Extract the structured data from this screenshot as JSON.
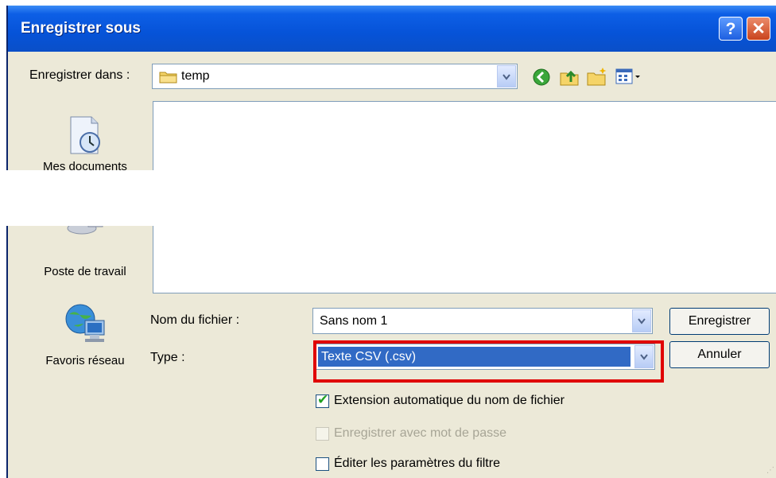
{
  "window": {
    "title": "Enregistrer sous",
    "help_label": "?",
    "close_label": "✕"
  },
  "save_in": {
    "label": "Enregistrer dans :",
    "value": "temp"
  },
  "toolbar": {
    "icons": [
      "back-icon",
      "up-folder-icon",
      "new-folder-icon",
      "view-menu-icon"
    ]
  },
  "places": [
    {
      "label": "Mes documents",
      "icon": "my-documents-icon"
    },
    {
      "label": "Poste de travail",
      "icon": "my-computer-icon"
    },
    {
      "label": "Favoris réseau",
      "icon": "network-places-icon"
    }
  ],
  "filename": {
    "label": "Nom du fichier :",
    "value": "Sans nom 1"
  },
  "filetype": {
    "label": "Type :",
    "value": "Texte CSV (.csv)"
  },
  "buttons": {
    "save": "Enregistrer",
    "cancel": "Annuler"
  },
  "options": [
    {
      "label": "Extension automatique du nom de fichier",
      "checked": true,
      "enabled": true
    },
    {
      "label": "Enregistrer avec mot de passe",
      "checked": false,
      "enabled": false
    },
    {
      "label": "Éditer les paramètres du filtre",
      "checked": false,
      "enabled": true
    }
  ],
  "colors": {
    "titlebar": "#0653d8",
    "highlight": "#e00000",
    "selection": "#316ac5"
  }
}
